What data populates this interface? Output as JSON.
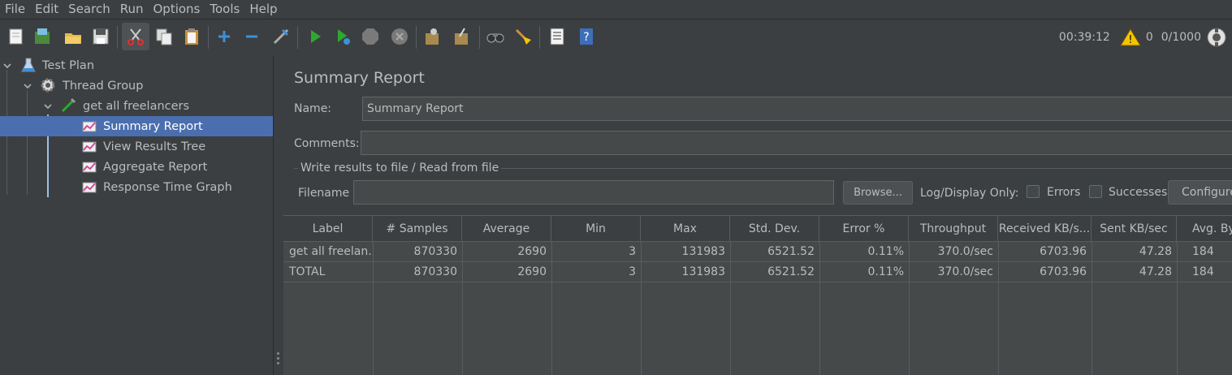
{
  "menu": [
    {
      "label": "File"
    },
    {
      "label": "Edit"
    },
    {
      "label": "Search"
    },
    {
      "label": "Run"
    },
    {
      "label": "Options"
    },
    {
      "label": "Tools"
    },
    {
      "label": "Help"
    }
  ],
  "toolbar_status": {
    "elapsed": "00:39:12",
    "warnings": "0",
    "threads": "0/1000"
  },
  "tree": [
    {
      "label": "Test Plan"
    },
    {
      "label": "Thread Group"
    },
    {
      "label": "get all freelancers"
    },
    {
      "label": "Summary Report"
    },
    {
      "label": "View Results Tree"
    },
    {
      "label": "Aggregate Report"
    },
    {
      "label": "Response Time Graph"
    }
  ],
  "panel": {
    "title": "Summary Report",
    "name_label": "Name:",
    "name_value": "Summary Report",
    "comments_label": "Comments:",
    "comments_value": "",
    "group_label": "Write results to file / Read from file",
    "filename_label": "Filename",
    "filename_value": "",
    "browse_label": "Browse...",
    "log_display_label": "Log/Display Only:",
    "errors_label": "Errors",
    "successes_label": "Successes",
    "configure_label": "Configure"
  },
  "table": {
    "headers": [
      "Label",
      "# Samples",
      "Average",
      "Min",
      "Max",
      "Std. Dev.",
      "Error %",
      "Throughput",
      "Received KB/s...",
      "Sent KB/sec",
      "Avg. By"
    ],
    "rows": [
      [
        "get all freelan...",
        "870330",
        "2690",
        "3",
        "131983",
        "6521.52",
        "0.11%",
        "370.0/sec",
        "6703.96",
        "47.28",
        "184"
      ],
      [
        "TOTAL",
        "870330",
        "2690",
        "3",
        "131983",
        "6521.52",
        "0.11%",
        "370.0/sec",
        "6703.96",
        "47.28",
        "184"
      ]
    ]
  },
  "colors": {
    "background": "#3c3f41",
    "selection": "#4b6eaf",
    "field": "#45494a",
    "text": "#bbbbbb",
    "run_green": "#2fa82f",
    "warning_yellow": "#f5c400"
  }
}
